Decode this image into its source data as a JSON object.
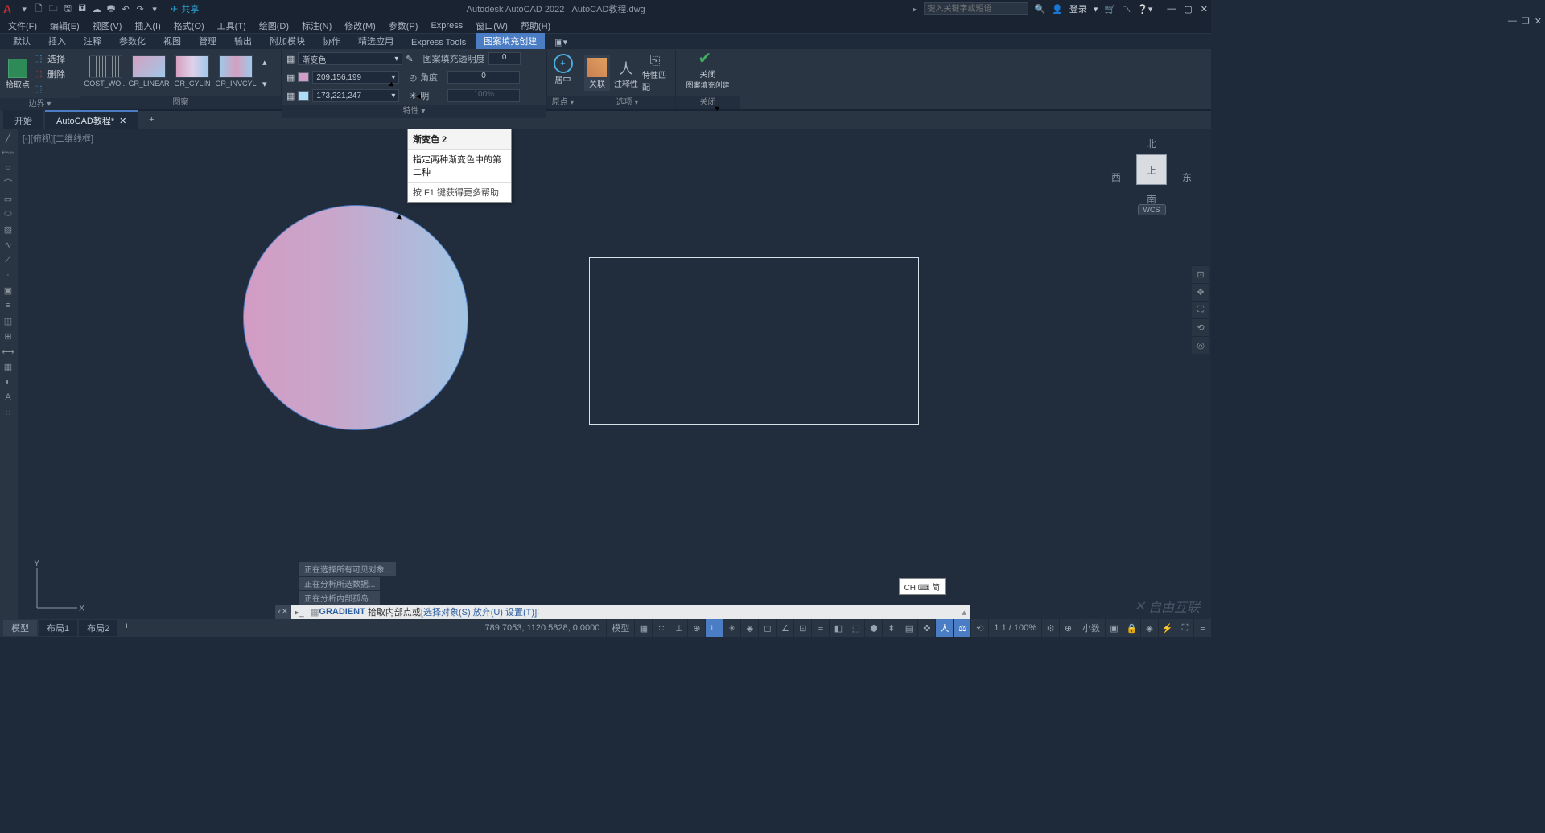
{
  "title": {
    "app": "Autodesk AutoCAD 2022",
    "file": "AutoCAD教程.dwg"
  },
  "qat": {
    "share": "共享"
  },
  "search": {
    "placeholder": "键入关键字或短语"
  },
  "login": "登录",
  "menu": [
    "文件(F)",
    "编辑(E)",
    "视图(V)",
    "插入(I)",
    "格式(O)",
    "工具(T)",
    "绘图(D)",
    "标注(N)",
    "修改(M)",
    "参数(P)",
    "Express",
    "窗口(W)",
    "帮助(H)"
  ],
  "ribbontabs": [
    "默认",
    "插入",
    "注释",
    "参数化",
    "视图",
    "管理",
    "输出",
    "附加模块",
    "协作",
    "精选应用",
    "Express Tools",
    "图案填充创建"
  ],
  "ribbon_active_index": 11,
  "panels": {
    "boundary": {
      "title": "边界 ▾",
      "pick": "拾取点",
      "select": "选择",
      "remove": "删除"
    },
    "pattern": {
      "title": "图案",
      "swatches": [
        {
          "name": "GOST_WO..."
        },
        {
          "name": "GR_LINEAR"
        },
        {
          "name": "GR_CYLIN"
        },
        {
          "name": "GR_INVCYL"
        }
      ]
    },
    "props": {
      "title": "特性 ▾",
      "type": "渐变色",
      "color1": "209,156,199",
      "color1_hex": "#d19cc7",
      "color2": "173,221,247",
      "color2_hex": "#addef7",
      "trans_label": "图案填充透明度",
      "trans_val": "0",
      "angle_label": "角度",
      "angle_val": "0",
      "bright_label": "明",
      "bright_val": "100%"
    },
    "origin": {
      "title": "原点 ▾",
      "center": "居中"
    },
    "options": {
      "title": "选项 ▾",
      "assoc": "关联",
      "annot": "注释性",
      "match": "特性匹配"
    },
    "close": {
      "title": "关闭",
      "close": "关闭",
      "ctx": "图案填充创建"
    }
  },
  "filetabs": {
    "start": "开始",
    "doc": "AutoCAD教程*"
  },
  "viewport_label": "[-][俯视][二维线框]",
  "tooltip": {
    "title": "渐变色 2",
    "body": "指定两种渐变色中的第二种",
    "help": "按 F1 键获得更多帮助"
  },
  "viewcube": {
    "n": "北",
    "s": "南",
    "e": "东",
    "w": "西",
    "face": "上",
    "wcs": "WCS"
  },
  "cmd_history": [
    "正在选择所有可见对象...",
    "正在分析所选数据...",
    "正在分析内部孤岛..."
  ],
  "cmdline": {
    "name": "GRADIENT",
    "prompt": "拾取内部点或 ",
    "opts": "[选择对象(S) 放弃(U) 设置(T)]",
    "end": ":"
  },
  "ime": "CH ⌨ 简",
  "watermark": "自由互联",
  "statusbar": {
    "tabs": [
      "模型",
      "布局1",
      "布局2"
    ],
    "coord": "789.7053, 1120.5828, 0.0000",
    "model": "模型",
    "scale": "1:1 / 100%",
    "dec": "小数",
    "gear": "⚙"
  }
}
